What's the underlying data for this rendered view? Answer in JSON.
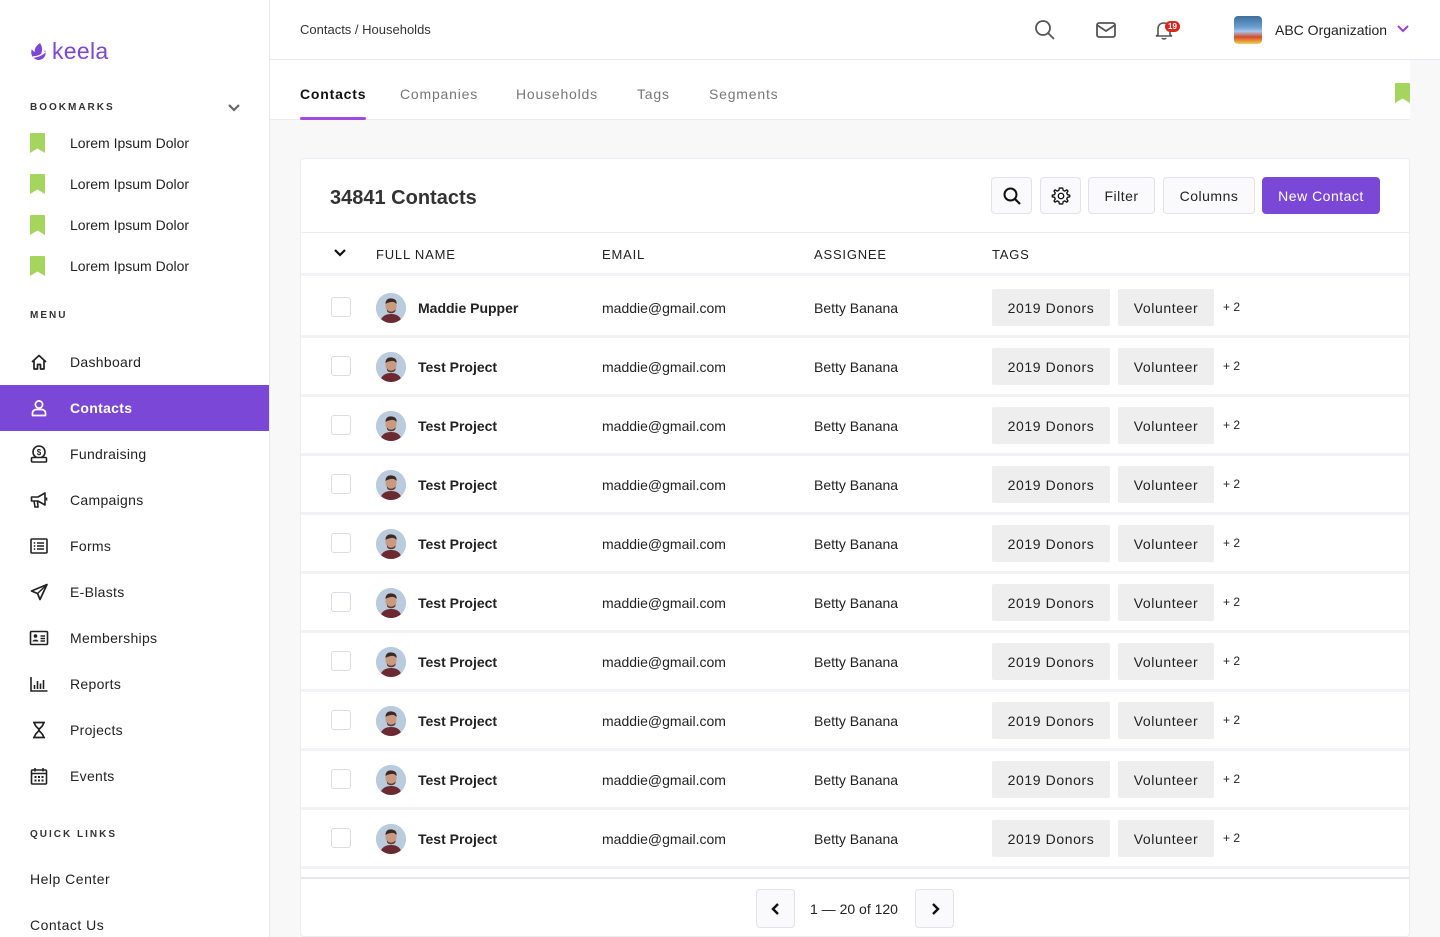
{
  "app": {
    "logo_text": "keela",
    "brand_color": "#7a47d6",
    "bookmark_color": "#a4d65e"
  },
  "sidebar": {
    "bookmarks_label": "BOOKMARKS",
    "bookmarks": [
      {
        "label": "Lorem Ipsum Dolor",
        "icon": "bookmark-icon"
      },
      {
        "label": "Lorem Ipsum Dolor",
        "icon": "bookmark-icon"
      },
      {
        "label": "Lorem Ipsum Dolor",
        "icon": "bookmark-icon"
      },
      {
        "label": "Lorem Ipsum Dolor",
        "icon": "bookmark-icon"
      }
    ],
    "menu_label": "MENU",
    "menu": [
      {
        "label": "Dashboard",
        "icon": "home-icon"
      },
      {
        "label": "Contacts",
        "icon": "user-icon",
        "active": true
      },
      {
        "label": "Fundraising",
        "icon": "donation-icon"
      },
      {
        "label": "Campaigns",
        "icon": "megaphone-icon"
      },
      {
        "label": "Forms",
        "icon": "list-form-icon"
      },
      {
        "label": "E-Blasts",
        "icon": "paper-plane-icon"
      },
      {
        "label": "Memberships",
        "icon": "id-card-icon"
      },
      {
        "label": "Reports",
        "icon": "bar-chart-icon"
      },
      {
        "label": "Projects",
        "icon": "hourglass-icon"
      },
      {
        "label": "Events",
        "icon": "calendar-icon"
      }
    ],
    "quick_links_label": "QUICK LINKS",
    "quick_links": [
      {
        "label": "Help Center"
      },
      {
        "label": "Contact Us"
      }
    ]
  },
  "header": {
    "breadcrumb": "Contacts / Households",
    "notification_count": "19",
    "org_name": "ABC Organization"
  },
  "tabs": [
    {
      "label": "Contacts",
      "active": true
    },
    {
      "label": "Companies"
    },
    {
      "label": "Households"
    },
    {
      "label": "Tags"
    },
    {
      "label": "Segments"
    }
  ],
  "main": {
    "title": "34841 Contacts",
    "buttons": {
      "filter": "Filter",
      "columns": "Columns",
      "new_contact": "New Contact"
    },
    "columns": [
      "FULL NAME",
      "EMAIL",
      "ASSIGNEE",
      "TAGS"
    ],
    "rows": [
      {
        "name": "Maddie Pupper",
        "email": "maddie@gmail.com",
        "assignee": "Betty Banana",
        "tags": [
          "2019 Donors",
          "Volunteer"
        ],
        "more": "+ 2"
      },
      {
        "name": "Test Project",
        "email": "maddie@gmail.com",
        "assignee": "Betty Banana",
        "tags": [
          "2019 Donors",
          "Volunteer"
        ],
        "more": "+ 2"
      },
      {
        "name": "Test Project",
        "email": "maddie@gmail.com",
        "assignee": "Betty Banana",
        "tags": [
          "2019 Donors",
          "Volunteer"
        ],
        "more": "+ 2"
      },
      {
        "name": "Test Project",
        "email": "maddie@gmail.com",
        "assignee": "Betty Banana",
        "tags": [
          "2019 Donors",
          "Volunteer"
        ],
        "more": "+ 2"
      },
      {
        "name": "Test Project",
        "email": "maddie@gmail.com",
        "assignee": "Betty Banana",
        "tags": [
          "2019 Donors",
          "Volunteer"
        ],
        "more": "+ 2"
      },
      {
        "name": "Test Project",
        "email": "maddie@gmail.com",
        "assignee": "Betty Banana",
        "tags": [
          "2019 Donors",
          "Volunteer"
        ],
        "more": "+ 2"
      },
      {
        "name": "Test Project",
        "email": "maddie@gmail.com",
        "assignee": "Betty Banana",
        "tags": [
          "2019 Donors",
          "Volunteer"
        ],
        "more": "+ 2"
      },
      {
        "name": "Test Project",
        "email": "maddie@gmail.com",
        "assignee": "Betty Banana",
        "tags": [
          "2019 Donors",
          "Volunteer"
        ],
        "more": "+ 2"
      },
      {
        "name": "Test Project",
        "email": "maddie@gmail.com",
        "assignee": "Betty Banana",
        "tags": [
          "2019 Donors",
          "Volunteer"
        ],
        "more": "+ 2"
      },
      {
        "name": "Test Project",
        "email": "maddie@gmail.com",
        "assignee": "Betty Banana",
        "tags": [
          "2019 Donors",
          "Volunteer"
        ],
        "more": "+ 2"
      }
    ],
    "pagination": "1 — 20 of 120"
  }
}
